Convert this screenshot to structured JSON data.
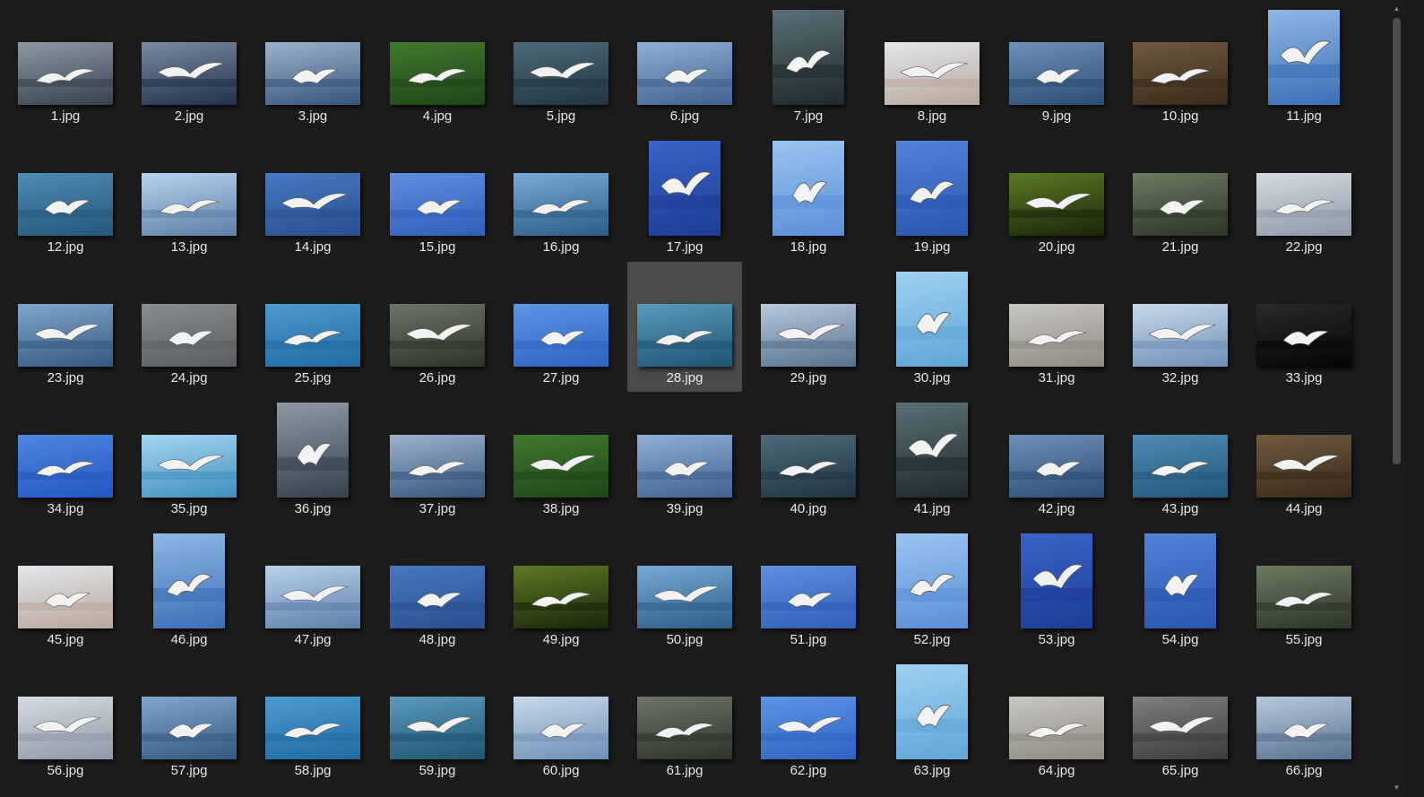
{
  "files": [
    {
      "name": "1.jpg",
      "orient": "landscape",
      "colors": [
        "#8d9aa6",
        "#35424d"
      ]
    },
    {
      "name": "2.jpg",
      "orient": "landscape",
      "colors": [
        "#7a8aa0",
        "#22304a"
      ]
    },
    {
      "name": "3.jpg",
      "orient": "landscape",
      "colors": [
        "#9db3cf",
        "#36557a"
      ]
    },
    {
      "name": "4.jpg",
      "orient": "landscape",
      "colors": [
        "#3f7a2e",
        "#1f4518"
      ]
    },
    {
      "name": "5.jpg",
      "orient": "landscape",
      "colors": [
        "#4d6a78",
        "#223541"
      ]
    },
    {
      "name": "6.jpg",
      "orient": "landscape",
      "colors": [
        "#8fb1d4",
        "#3e6190"
      ]
    },
    {
      "name": "7.jpg",
      "orient": "portrait",
      "colors": [
        "#5b6e75",
        "#1e2b30"
      ]
    },
    {
      "name": "8.jpg",
      "orient": "landscape",
      "colors": [
        "#e2e6ec",
        "#b8a79a"
      ]
    },
    {
      "name": "9.jpg",
      "orient": "landscape",
      "colors": [
        "#6d91b8",
        "#2d4d73"
      ]
    },
    {
      "name": "10.jpg",
      "orient": "landscape",
      "colors": [
        "#6e5a3e",
        "#3a2a1c"
      ]
    },
    {
      "name": "11.jpg",
      "orient": "portrait",
      "colors": [
        "#8fb7e6",
        "#3b6fb5"
      ]
    },
    {
      "name": "12.jpg",
      "orient": "landscape",
      "colors": [
        "#4f8bb3",
        "#24577a"
      ]
    },
    {
      "name": "13.jpg",
      "orient": "landscape",
      "colors": [
        "#b7d2ee",
        "#5d7fa6"
      ]
    },
    {
      "name": "14.jpg",
      "orient": "landscape",
      "colors": [
        "#4778c2",
        "#2a4f8f"
      ]
    },
    {
      "name": "15.jpg",
      "orient": "landscape",
      "colors": [
        "#5e8fe0",
        "#2f5fb8"
      ]
    },
    {
      "name": "16.jpg",
      "orient": "landscape",
      "colors": [
        "#79a9d6",
        "#2d5d86"
      ]
    },
    {
      "name": "17.jpg",
      "orient": "portrait",
      "colors": [
        "#3a64c8",
        "#1d3d96"
      ]
    },
    {
      "name": "18.jpg",
      "orient": "portrait",
      "colors": [
        "#9cc3f0",
        "#5a8fd8"
      ]
    },
    {
      "name": "19.jpg",
      "orient": "portrait",
      "colors": [
        "#5482d9",
        "#2a56b0"
      ]
    },
    {
      "name": "20.jpg",
      "orient": "landscape",
      "colors": [
        "#5b7a24",
        "#1a260a"
      ]
    },
    {
      "name": "21.jpg",
      "orient": "landscape",
      "colors": [
        "#6c7a62",
        "#2c3526"
      ]
    },
    {
      "name": "22.jpg",
      "orient": "landscape",
      "colors": [
        "#d5dbe2",
        "#8d99a6"
      ]
    },
    {
      "name": "23.jpg",
      "orient": "landscape",
      "colors": [
        "#7fa6cc",
        "#34597e"
      ]
    },
    {
      "name": "24.jpg",
      "orient": "landscape",
      "colors": [
        "#8a8c8e",
        "#5a5e62"
      ]
    },
    {
      "name": "25.jpg",
      "orient": "landscape",
      "colors": [
        "#4e9ad2",
        "#216aa2"
      ]
    },
    {
      "name": "26.jpg",
      "orient": "landscape",
      "colors": [
        "#6d7566",
        "#2e3327"
      ]
    },
    {
      "name": "27.jpg",
      "orient": "landscape",
      "colors": [
        "#5b95e6",
        "#2e64c2"
      ]
    },
    {
      "name": "28.jpg",
      "orient": "landscape",
      "colors": [
        "#5a9bbd",
        "#1e5470"
      ]
    },
    {
      "name": "29.jpg",
      "orient": "landscape",
      "colors": [
        "#b9c9dc",
        "#56708e"
      ]
    },
    {
      "name": "30.jpg",
      "orient": "portrait",
      "colors": [
        "#9fd0ef",
        "#5ea6d8"
      ]
    },
    {
      "name": "31.jpg",
      "orient": "landscape",
      "colors": [
        "#c8c6c1",
        "#8e8b84"
      ]
    },
    {
      "name": "32.jpg",
      "orient": "landscape",
      "colors": [
        "#c9d8ea",
        "#6d8fb6"
      ]
    },
    {
      "name": "33.jpg",
      "orient": "landscape",
      "colors": [
        "#2a2a2a",
        "#050505"
      ]
    },
    {
      "name": "34.jpg",
      "orient": "landscape",
      "colors": [
        "#4d86e0",
        "#2358c0"
      ]
    },
    {
      "name": "35.jpg",
      "orient": "landscape",
      "colors": [
        "#a6d6f0",
        "#3f8fbf"
      ]
    },
    {
      "name": "36.jpg",
      "orient": "portrait",
      "colors": [
        "#8d9aa6",
        "#35424d"
      ]
    },
    {
      "name": "37.jpg",
      "orient": "landscape",
      "colors": [
        "#9db3cf",
        "#36557a"
      ]
    },
    {
      "name": "38.jpg",
      "orient": "landscape",
      "colors": [
        "#3f7a2e",
        "#1f4518"
      ]
    },
    {
      "name": "39.jpg",
      "orient": "landscape",
      "colors": [
        "#8fb1d4",
        "#3e6190"
      ]
    },
    {
      "name": "40.jpg",
      "orient": "landscape",
      "colors": [
        "#4d6a78",
        "#223541"
      ]
    },
    {
      "name": "41.jpg",
      "orient": "portrait",
      "colors": [
        "#5b6e75",
        "#1e2b30"
      ]
    },
    {
      "name": "42.jpg",
      "orient": "landscape",
      "colors": [
        "#6d91b8",
        "#2d4d73"
      ]
    },
    {
      "name": "43.jpg",
      "orient": "landscape",
      "colors": [
        "#4f8bb3",
        "#24577a"
      ]
    },
    {
      "name": "44.jpg",
      "orient": "landscape",
      "colors": [
        "#6e5a3e",
        "#3a2a1c"
      ]
    },
    {
      "name": "45.jpg",
      "orient": "landscape",
      "colors": [
        "#e2e6ec",
        "#b8a79a"
      ]
    },
    {
      "name": "46.jpg",
      "orient": "portrait",
      "colors": [
        "#8fb7e6",
        "#3b6fb5"
      ]
    },
    {
      "name": "47.jpg",
      "orient": "landscape",
      "colors": [
        "#b7d2ee",
        "#5d7fa6"
      ]
    },
    {
      "name": "48.jpg",
      "orient": "landscape",
      "colors": [
        "#4778c2",
        "#2a4f8f"
      ]
    },
    {
      "name": "49.jpg",
      "orient": "landscape",
      "colors": [
        "#5b7a24",
        "#1a260a"
      ]
    },
    {
      "name": "50.jpg",
      "orient": "landscape",
      "colors": [
        "#79a9d6",
        "#2d5d86"
      ]
    },
    {
      "name": "51.jpg",
      "orient": "landscape",
      "colors": [
        "#5e8fe0",
        "#2f5fb8"
      ]
    },
    {
      "name": "52.jpg",
      "orient": "portrait",
      "colors": [
        "#9cc3f0",
        "#5a8fd8"
      ]
    },
    {
      "name": "53.jpg",
      "orient": "portrait",
      "colors": [
        "#3a64c8",
        "#1d3d96"
      ]
    },
    {
      "name": "54.jpg",
      "orient": "portrait",
      "colors": [
        "#5482d9",
        "#2a56b0"
      ]
    },
    {
      "name": "55.jpg",
      "orient": "landscape",
      "colors": [
        "#6c7a62",
        "#2c3526"
      ]
    },
    {
      "name": "56.jpg",
      "orient": "landscape",
      "colors": [
        "#d5dbe2",
        "#8d99a6"
      ]
    },
    {
      "name": "57.jpg",
      "orient": "landscape",
      "colors": [
        "#7fa6cc",
        "#34597e"
      ]
    },
    {
      "name": "58.jpg",
      "orient": "landscape",
      "colors": [
        "#4e9ad2",
        "#216aa2"
      ]
    },
    {
      "name": "59.jpg",
      "orient": "landscape",
      "colors": [
        "#5a9bbd",
        "#1e5470"
      ]
    },
    {
      "name": "60.jpg",
      "orient": "landscape",
      "colors": [
        "#c9d8ea",
        "#6d8fb6"
      ]
    },
    {
      "name": "61.jpg",
      "orient": "landscape",
      "colors": [
        "#6d7566",
        "#2e3327"
      ]
    },
    {
      "name": "62.jpg",
      "orient": "landscape",
      "colors": [
        "#5b95e6",
        "#2e64c2"
      ]
    },
    {
      "name": "63.jpg",
      "orient": "portrait",
      "colors": [
        "#9fd0ef",
        "#5ea6d8"
      ]
    },
    {
      "name": "64.jpg",
      "orient": "landscape",
      "colors": [
        "#c8c6c1",
        "#8e8b84"
      ]
    },
    {
      "name": "65.jpg",
      "orient": "landscape",
      "colors": [
        "#7d7f80",
        "#3a3c3e"
      ]
    },
    {
      "name": "66.jpg",
      "orient": "landscape",
      "colors": [
        "#b9c9dc",
        "#56708e"
      ]
    }
  ],
  "selected_file": "28.jpg",
  "scrollbar": {
    "up_icon": "scroll-up-arrow-icon",
    "down_icon": "scroll-down-arrow-icon",
    "position_fraction": 0.0
  }
}
